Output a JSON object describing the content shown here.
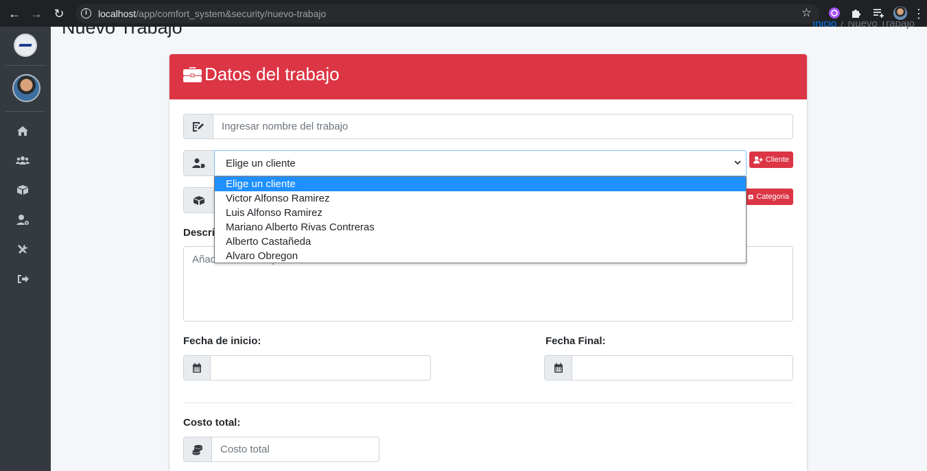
{
  "browser": {
    "url_host": "localhost",
    "url_path": "/app/comfort_system&security/nuevo-trabajo"
  },
  "page": {
    "title": "Nuevo Trabajo",
    "breadcrumb_home": "Inicio",
    "breadcrumb_sep": "/",
    "breadcrumb_current": "Nuevo Trabajo"
  },
  "sidebar": {
    "items": [
      {
        "name": "home-icon"
      },
      {
        "name": "users-icon"
      },
      {
        "name": "boxes-icon"
      },
      {
        "name": "user-cog-icon"
      },
      {
        "name": "tools-icon"
      },
      {
        "name": "sign-out-icon"
      }
    ]
  },
  "form": {
    "header_title": "Datos del trabajo",
    "name_placeholder": "Ingresar nombre del trabajo",
    "client_select_value": "Elige un cliente",
    "client_button_label": "Cliente",
    "category_button_label": "Categoria",
    "client_options": [
      "Elige un cliente",
      "Victor Alfonso Ramirez",
      "Luis Alfonso Ramirez",
      "Mariano Alberto Rivas Contreras",
      "Alberto Castañeda",
      "Alvaro Obregon"
    ],
    "description_label": "Descripción:",
    "description_placeholder": "Añadir una descripción",
    "start_date_label": "Fecha de inicio:",
    "end_date_label": "Fecha Final:",
    "total_cost_label": "Costo total:",
    "total_cost_placeholder": "Costo total"
  },
  "colors": {
    "accent": "#dc3545",
    "sidebar": "#343a40",
    "highlight": "#1e90ff"
  }
}
